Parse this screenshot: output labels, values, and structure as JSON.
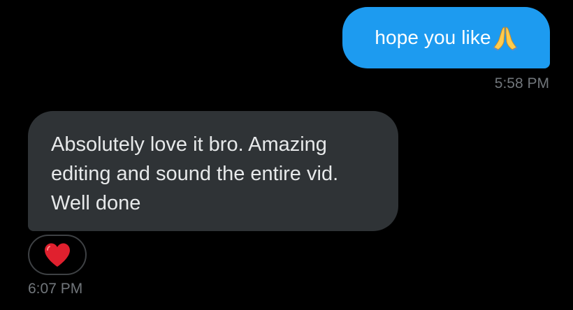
{
  "messages": [
    {
      "direction": "outgoing",
      "text": "hope you like",
      "emoji": "folded-hands-emoji",
      "time": "5:58 PM"
    },
    {
      "direction": "incoming",
      "lines": [
        "Absolutely love it bro. Amazing",
        "editing and sound the entire vid.",
        "Well done"
      ],
      "reaction": "red-heart-emoji",
      "time": "6:07 PM"
    }
  ],
  "colors": {
    "background": "#000000",
    "outgoing_bubble": "#1d9bf0",
    "incoming_bubble": "#2f3336",
    "timestamp": "#71767b",
    "heart": "#e0202e"
  }
}
